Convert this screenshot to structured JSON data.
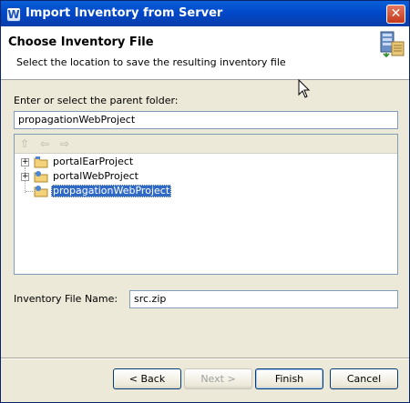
{
  "window": {
    "title": "Import Inventory from Server",
    "close_glyph": "✕"
  },
  "banner": {
    "title": "Choose Inventory File",
    "subtitle": "Select the location to save the resulting inventory file",
    "icon": "import-wizard-icon"
  },
  "parent_folder": {
    "label": "Enter or select the parent folder:",
    "value": "propagationWebProject"
  },
  "tree": {
    "toolbar": [
      {
        "icon": "go-up-icon",
        "glyph": "⇧"
      },
      {
        "icon": "back-arrow-icon",
        "glyph": "⇦"
      },
      {
        "icon": "forward-arrow-icon",
        "glyph": "⇨"
      }
    ],
    "items": [
      {
        "label": "portalEarProject",
        "expandable": true,
        "selected": false
      },
      {
        "label": "portalWebProject",
        "expandable": true,
        "selected": false
      },
      {
        "label": "propagationWebProject",
        "expandable": false,
        "selected": true
      }
    ]
  },
  "inventory_file": {
    "label": "Inventory File Name:",
    "value": "src.zip"
  },
  "buttons": {
    "back": "< Back",
    "next": "Next >",
    "finish": "Finish",
    "cancel": "Cancel"
  },
  "colors": {
    "titlebar": "#0046c8",
    "selection": "#316ac5",
    "dialog_bg": "#ece9d8"
  }
}
